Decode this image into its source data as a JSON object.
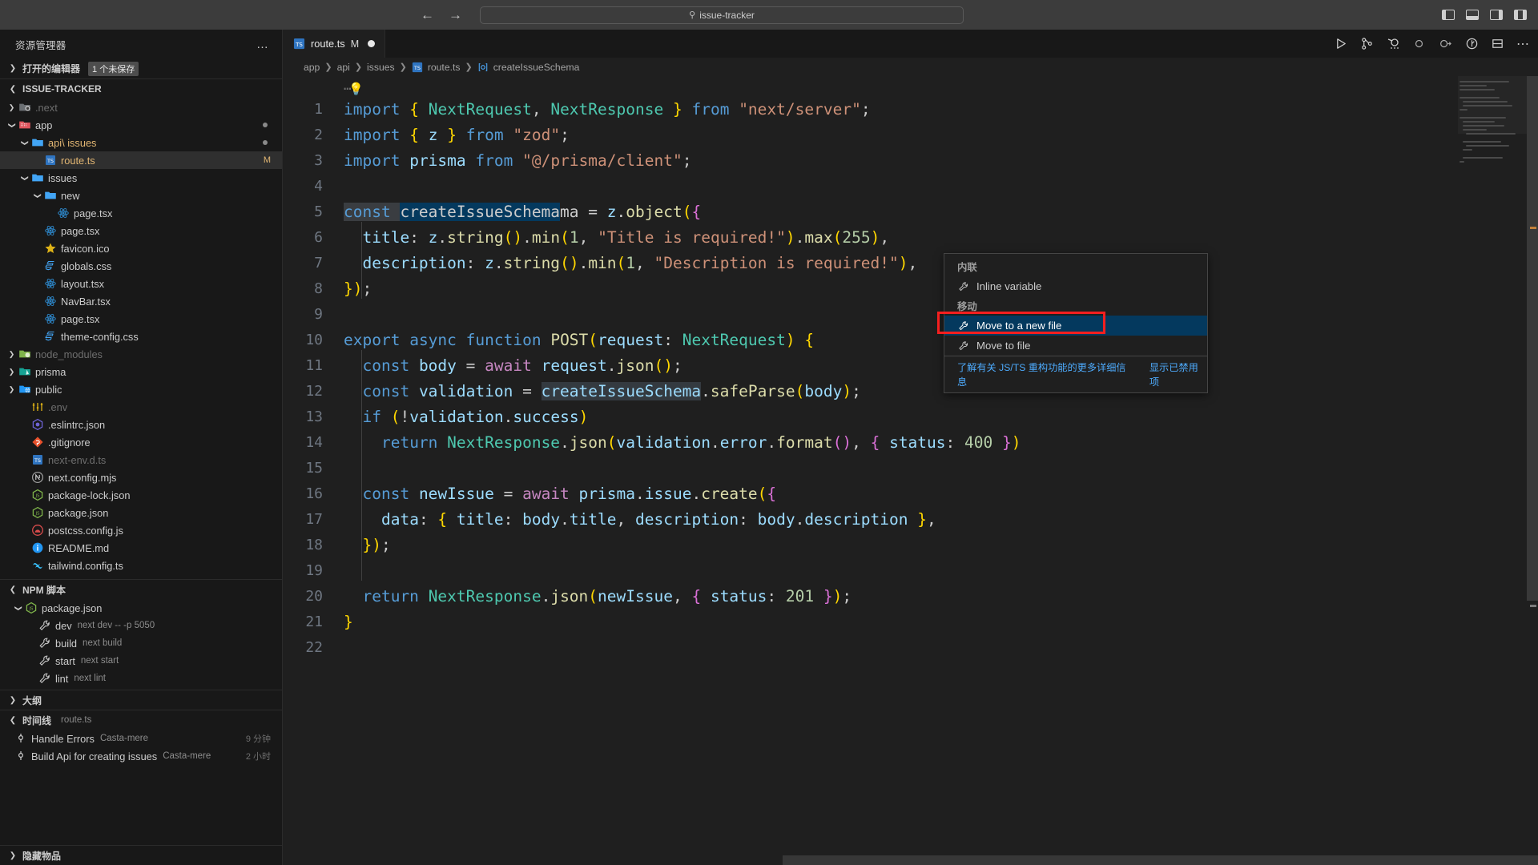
{
  "titlebar": {
    "back_icon": "arrow-left-icon",
    "forward_icon": "arrow-right-icon",
    "search_text": "issue-tracker",
    "search_icon": "search-icon",
    "layout_icons": [
      "toggle-primary-sidebar-icon",
      "toggle-panel-icon",
      "toggle-secondary-sidebar-icon",
      "customize-layout-icon"
    ]
  },
  "sidebar": {
    "title": "资源管理器",
    "more_actions": "…",
    "open_editors": {
      "label": "打开的编辑器",
      "badge": "1 个未保存"
    },
    "workspace": {
      "label": "ISSUE-TRACKER"
    },
    "tree": [
      {
        "label": ".next",
        "indent": 1,
        "chev": "›",
        "icon": "folder-next-icon",
        "dim": true
      },
      {
        "label": "app",
        "indent": 1,
        "chev": "⌄",
        "icon": "folder-app-icon",
        "dim": false,
        "modified_dot": true
      },
      {
        "label": "api\\ issues",
        "indent": 2,
        "chev": "⌄",
        "icon": "folder-open-icon",
        "dim": false,
        "amber": true,
        "modified_dot": true
      },
      {
        "label": "route.ts",
        "indent": 3,
        "chev": "",
        "icon": "ts-file-icon",
        "amber": true,
        "selected": true,
        "mark": "M"
      },
      {
        "label": "issues",
        "indent": 2,
        "chev": "⌄",
        "icon": "folder-open-icon"
      },
      {
        "label": "new",
        "indent": 3,
        "chev": "⌄",
        "icon": "folder-open-icon"
      },
      {
        "label": "page.tsx",
        "indent": 4,
        "chev": "",
        "icon": "react-icon"
      },
      {
        "label": "page.tsx",
        "indent": 3,
        "chev": "",
        "icon": "react-icon"
      },
      {
        "label": "favicon.ico",
        "indent": 3,
        "chev": "",
        "icon": "star-icon"
      },
      {
        "label": "globals.css",
        "indent": 3,
        "chev": "",
        "icon": "css-icon"
      },
      {
        "label": "layout.tsx",
        "indent": 3,
        "chev": "",
        "icon": "react-icon"
      },
      {
        "label": "NavBar.tsx",
        "indent": 3,
        "chev": "",
        "icon": "react-icon"
      },
      {
        "label": "page.tsx",
        "indent": 3,
        "chev": "",
        "icon": "react-icon"
      },
      {
        "label": "theme-config.css",
        "indent": 3,
        "chev": "",
        "icon": "css-icon"
      },
      {
        "label": "node_modules",
        "indent": 1,
        "chev": "›",
        "icon": "folder-node-icon",
        "dim": true
      },
      {
        "label": "prisma",
        "indent": 1,
        "chev": "›",
        "icon": "folder-prisma-icon"
      },
      {
        "label": "public",
        "indent": 1,
        "chev": "›",
        "icon": "folder-public-icon"
      },
      {
        "label": ".env",
        "indent": 2,
        "chev": "",
        "icon": "env-icon",
        "dim": true
      },
      {
        "label": ".eslintrc.json",
        "indent": 2,
        "chev": "",
        "icon": "eslint-icon"
      },
      {
        "label": ".gitignore",
        "indent": 2,
        "chev": "",
        "icon": "git-icon"
      },
      {
        "label": "next-env.d.ts",
        "indent": 2,
        "chev": "",
        "icon": "ts-file-icon",
        "dim": true
      },
      {
        "label": "next.config.mjs",
        "indent": 2,
        "chev": "",
        "icon": "next-icon"
      },
      {
        "label": "package-lock.json",
        "indent": 2,
        "chev": "",
        "icon": "npm-icon"
      },
      {
        "label": "package.json",
        "indent": 2,
        "chev": "",
        "icon": "npm-icon"
      },
      {
        "label": "postcss.config.js",
        "indent": 2,
        "chev": "",
        "icon": "postcss-icon"
      },
      {
        "label": "README.md",
        "indent": 2,
        "chev": "",
        "icon": "info-icon"
      },
      {
        "label": "tailwind.config.ts",
        "indent": 2,
        "chev": "",
        "icon": "tailwind-icon"
      }
    ],
    "npm_scripts": {
      "label": "NPM 脚本",
      "root": "package.json",
      "items": [
        {
          "name": "dev",
          "cmd": "next dev -- -p 5050"
        },
        {
          "name": "build",
          "cmd": "next build"
        },
        {
          "name": "start",
          "cmd": "next start"
        },
        {
          "name": "lint",
          "cmd": "next lint"
        }
      ]
    },
    "outline": {
      "label": "大纲"
    },
    "timeline": {
      "label": "时间线",
      "file": "route.ts",
      "entries": [
        {
          "title": "Handle Errors",
          "author": "Casta-mere",
          "time": "9 分钟"
        },
        {
          "title": "Build Api for creating issues",
          "author": "Casta-mere",
          "time": "2 小时"
        }
      ]
    },
    "hidden_items": {
      "label": "隐藏物品"
    }
  },
  "editor": {
    "tab": {
      "name": "route.ts",
      "modified_flag": "M",
      "icon": "ts-file-icon"
    },
    "actions": [
      "run-icon",
      "source-control-icon",
      "rest-client-icon",
      "circle-icon",
      "circle-arrow-icon",
      "debug-icon",
      "split-editor-icon",
      "more-actions-icon"
    ],
    "breadcrumb": [
      "app",
      "api",
      "issues",
      "route.ts",
      "createIssueSchema"
    ],
    "breadcrumb_symbol_icon": "variable-symbol-icon",
    "folded_marker": "…",
    "lines": [
      {
        "n": 1,
        "raw": "import { NextRequest, NextResponse } from \"next/server\";"
      },
      {
        "n": 2,
        "raw": "import { z } from \"zod\";"
      },
      {
        "n": 3,
        "raw": "import prisma from \"@/prisma/client\";"
      },
      {
        "n": 4,
        "raw": ""
      },
      {
        "n": 5,
        "raw": "const createIssueSchema = z.object({"
      },
      {
        "n": 6,
        "raw": "  title: z.string().min(1, \"Title is required!\").max(255),"
      },
      {
        "n": 7,
        "raw": "  description: z.string().min(1, \"Description is required!\"),"
      },
      {
        "n": 8,
        "raw": "});"
      },
      {
        "n": 9,
        "raw": ""
      },
      {
        "n": 10,
        "raw": "export async function POST(request: NextRequest) {"
      },
      {
        "n": 11,
        "raw": "  const body = await request.json();"
      },
      {
        "n": 12,
        "raw": "  const validation = createIssueSchema.safeParse(body);"
      },
      {
        "n": 13,
        "raw": "  if (!validation.success)"
      },
      {
        "n": 14,
        "raw": "    return NextResponse.json(validation.error.format(), { status: 400 })"
      },
      {
        "n": 15,
        "raw": ""
      },
      {
        "n": 16,
        "raw": "  const newIssue = await prisma.issue.create({"
      },
      {
        "n": 17,
        "raw": "    data: { title: body.title, description: body.description },"
      },
      {
        "n": 18,
        "raw": "  });"
      },
      {
        "n": 19,
        "raw": ""
      },
      {
        "n": 20,
        "raw": "  return NextResponse.json(newIssue, { status: 201 });"
      },
      {
        "n": 21,
        "raw": "}"
      },
      {
        "n": 22,
        "raw": ""
      }
    ],
    "lightbulb_icon": "lightbulb-icon"
  },
  "context_menu": {
    "groups": [
      {
        "title": "内联",
        "items": [
          {
            "label": "Inline variable",
            "icon": "wrench-icon",
            "active": false
          }
        ]
      },
      {
        "title": "移动",
        "items": [
          {
            "label": "Move to a new file",
            "icon": "wrench-icon",
            "active": true
          },
          {
            "label": "Move to file",
            "icon": "wrench-icon",
            "active": false
          }
        ]
      }
    ],
    "footer": {
      "learn_more": "了解有关 JS/TS 重构功能的更多详细信息",
      "show_disabled": "显示已禁用项"
    }
  },
  "colors": {
    "accent": "#04395e",
    "highlight_box": "#f41f1f",
    "link": "#4daafc",
    "folder_amber": "#e2b673"
  }
}
